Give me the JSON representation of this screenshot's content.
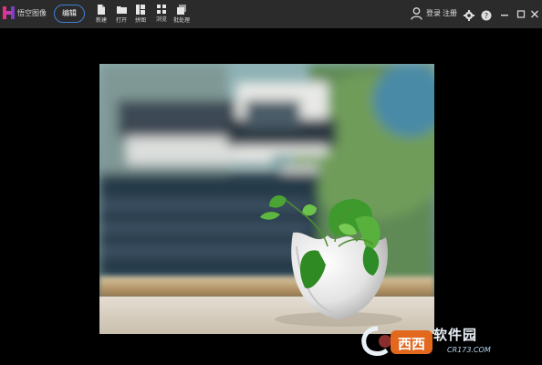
{
  "app": {
    "name": "悟空图像",
    "mode_label": "编辑"
  },
  "toolbar": {
    "items": [
      {
        "label": "新建",
        "icon": "new-file-icon"
      },
      {
        "label": "打开",
        "icon": "open-folder-icon"
      },
      {
        "label": "拼图",
        "icon": "collage-icon"
      },
      {
        "label": "浏览",
        "icon": "browse-grid-icon"
      },
      {
        "label": "批处理",
        "icon": "batch-icon"
      }
    ]
  },
  "account": {
    "login_label": "登录",
    "register_label": "注册"
  },
  "window_controls": [
    "settings-icon",
    "help-icon",
    "minimize-icon",
    "maximize-icon",
    "close-icon"
  ],
  "watermark": {
    "brand_text": "软件园",
    "url_text": "CR173.COM",
    "logo_text": "西西"
  },
  "colors": {
    "titlebar": "#2b2b2b",
    "workspace": "#000000",
    "mode_button_border": "#3e7fd4",
    "logo_pink": "#e4318a",
    "logo_purple": "#7b3fc6"
  }
}
